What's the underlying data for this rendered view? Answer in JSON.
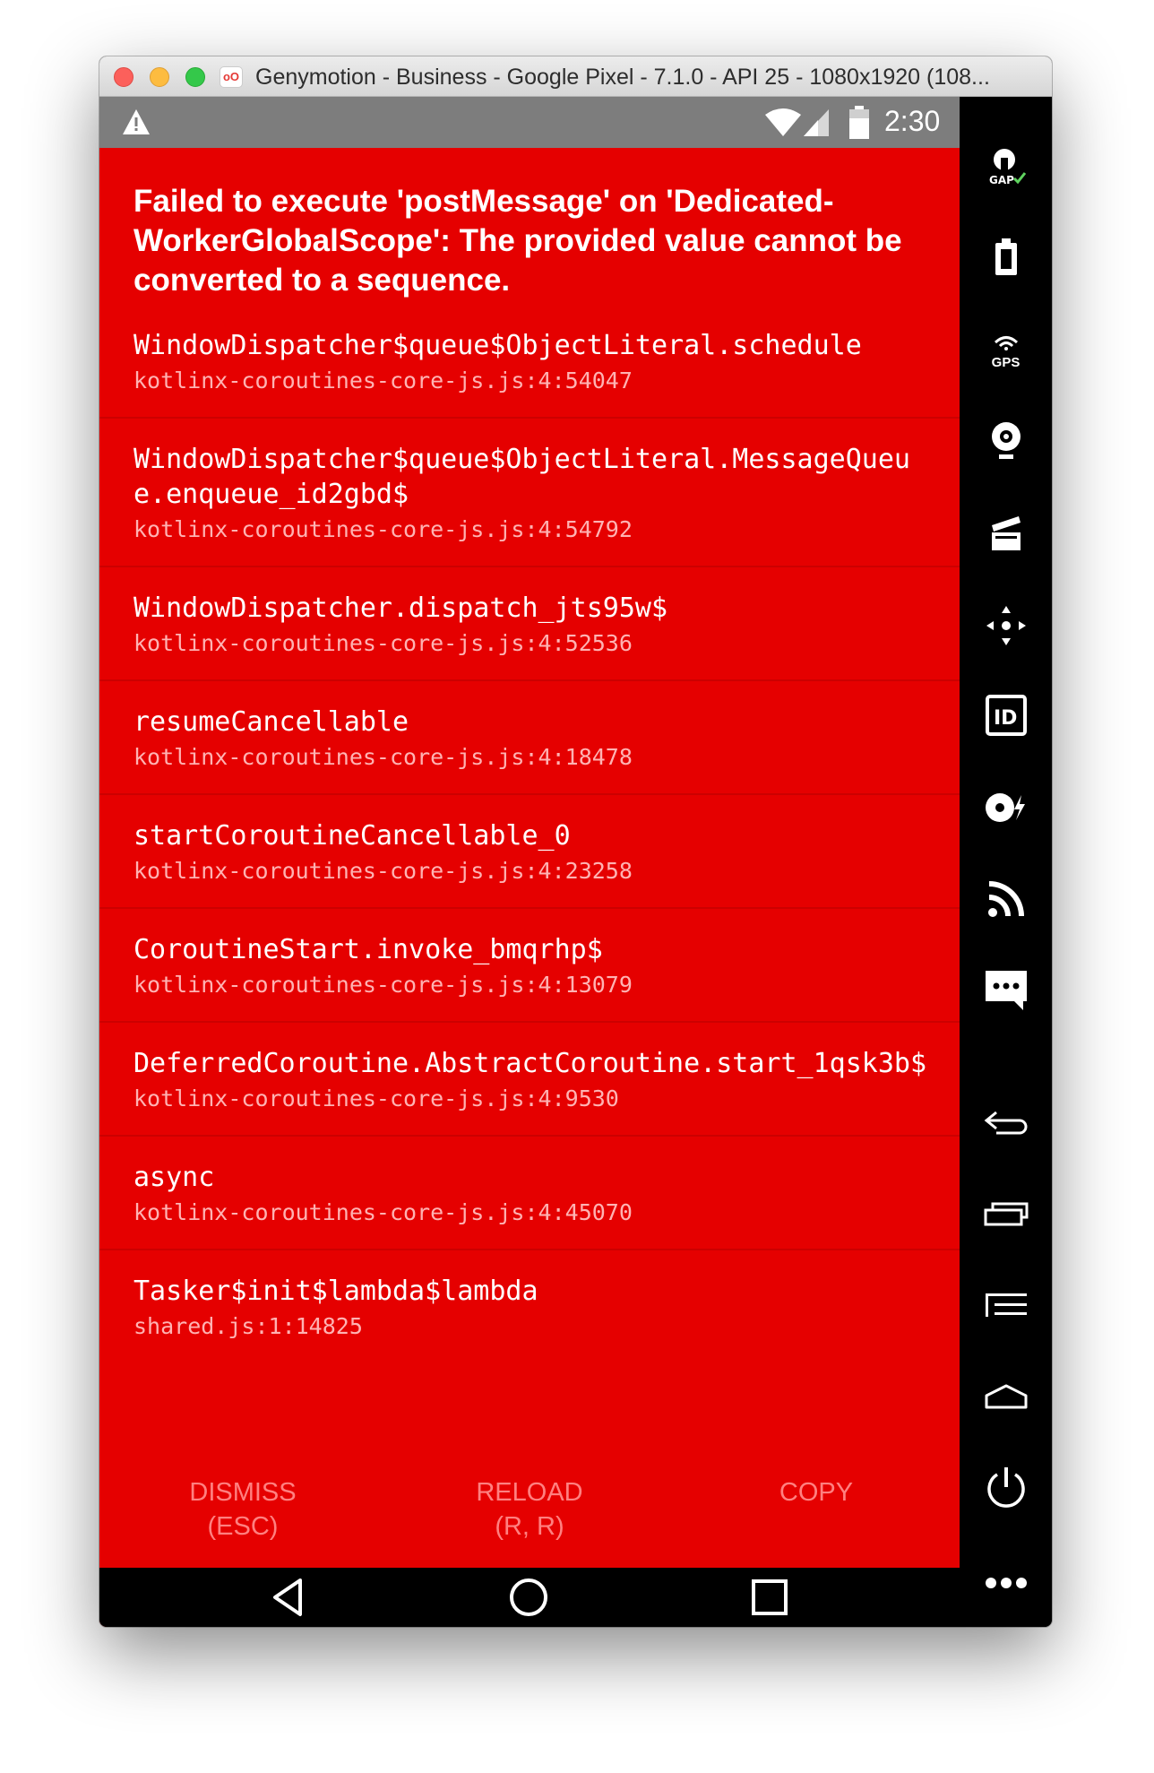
{
  "window": {
    "title": "Genymotion - Business - Google Pixel - 7.1.0 - API 25 - 1080x1920 (108...",
    "app_icon": "oO"
  },
  "status_bar": {
    "time": "2:30",
    "icons": [
      "warning-icon",
      "wifi-icon",
      "signal-icon",
      "battery-icon"
    ]
  },
  "error": {
    "title": "Failed to execute 'postMessage' on 'Dedicated-WorkerGlobalScope': The provided value cannot be converted to a sequence.",
    "stack": [
      {
        "fn": "WindowDispatcher$queue$ObjectLiteral.schedule",
        "loc": "kotlinx-coroutines-core-js.js:4:54047"
      },
      {
        "fn": "WindowDispatcher$queue$ObjectLiteral.MessageQueue.enqueue_id2gbd$",
        "loc": "kotlinx-coroutines-core-js.js:4:54792"
      },
      {
        "fn": "WindowDispatcher.dispatch_jts95w$",
        "loc": "kotlinx-coroutines-core-js.js:4:52536"
      },
      {
        "fn": "resumeCancellable",
        "loc": "kotlinx-coroutines-core-js.js:4:18478"
      },
      {
        "fn": "startCoroutineCancellable_0",
        "loc": "kotlinx-coroutines-core-js.js:4:23258"
      },
      {
        "fn": "CoroutineStart.invoke_bmqrhp$",
        "loc": "kotlinx-coroutines-core-js.js:4:13079"
      },
      {
        "fn": "DeferredCoroutine.AbstractCoroutine.start_1qsk3b$",
        "loc": "kotlinx-coroutines-core-js.js:4:9530"
      },
      {
        "fn": "async",
        "loc": "kotlinx-coroutines-core-js.js:4:45070"
      },
      {
        "fn": "Tasker$init$lambda$lambda",
        "loc": "shared.js:1:14825"
      }
    ]
  },
  "actions": {
    "dismiss": {
      "line1": "DISMISS",
      "line2": "(ESC)"
    },
    "reload": {
      "line1": "RELOAD",
      "line2": "(R, R)"
    },
    "copy": {
      "line1": "COPY"
    }
  },
  "toolbar": {
    "gaps_label": "GAPPS",
    "gps_label": "GPS",
    "id_label": "ID",
    "items": [
      "gapps-icon",
      "battery-icon",
      "gps-icon",
      "webcam-icon",
      "screencast-icon",
      "dpad-icon",
      "device-id-icon",
      "disk-io-icon",
      "network-icon",
      "sms-icon",
      "back-icon",
      "recent-apps-icon",
      "menu-icon",
      "home-icon",
      "power-icon",
      "more-icon"
    ]
  },
  "colors": {
    "error_background": "#e50000",
    "status_bar": "#7d7d7d",
    "action_text": "#ff8080",
    "location_text": "#ffb3b3"
  }
}
